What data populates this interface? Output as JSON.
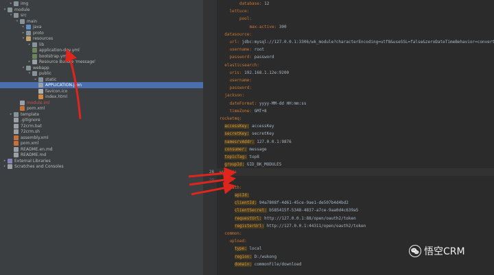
{
  "tree": {
    "rows": [
      {
        "label": "img",
        "indent": 1,
        "arrow": "▸",
        "icon": "folder",
        "icon_name": "folder-icon"
      },
      {
        "label": "module",
        "indent": 0,
        "arrow": "▾",
        "icon": "folder",
        "icon_name": "folder-icon"
      },
      {
        "label": "src",
        "indent": 1,
        "arrow": "▾",
        "icon": "folder",
        "icon_name": "folder-icon"
      },
      {
        "label": "main",
        "indent": 2,
        "arrow": "▾",
        "icon": "folder",
        "icon_name": "folder-icon"
      },
      {
        "label": "java",
        "indent": 3,
        "arrow": "▸",
        "icon": "folder-src",
        "icon_name": "source-folder-icon"
      },
      {
        "label": "proto",
        "indent": 3,
        "arrow": "▸",
        "icon": "folder",
        "icon_name": "folder-icon"
      },
      {
        "label": "resources",
        "indent": 3,
        "arrow": "▾",
        "icon": "folder-res",
        "icon_name": "resources-folder-icon"
      },
      {
        "label": "lib",
        "indent": 4,
        "arrow": "▸",
        "icon": "folder",
        "icon_name": "folder-icon"
      },
      {
        "label": "application-dev.yml",
        "indent": 4,
        "arrow": "",
        "icon": "file-yml",
        "icon_name": "yaml-file-icon"
      },
      {
        "label": "bootstrap.yml",
        "indent": 4,
        "arrow": "",
        "icon": "file-yml",
        "icon_name": "yaml-file-icon"
      },
      {
        "label": "Resource Bundle 'message'",
        "indent": 4,
        "arrow": "▸",
        "icon": "file-txt",
        "icon_name": "resource-bundle-icon"
      },
      {
        "label": "webapp",
        "indent": 3,
        "arrow": "▾",
        "icon": "folder",
        "icon_name": "folder-icon"
      },
      {
        "label": "public",
        "indent": 4,
        "arrow": "▾",
        "icon": "folder",
        "icon_name": "folder-icon"
      },
      {
        "label": "static",
        "indent": 5,
        "arrow": "▸",
        "icon": "folder",
        "icon_name": "folder-icon"
      },
      {
        "label": "APPLICATION.json",
        "indent": 5,
        "arrow": "",
        "icon": "file-txt",
        "icon_name": "json-file-icon",
        "selected": true
      },
      {
        "label": "favicon.ico",
        "indent": 5,
        "arrow": "",
        "icon": "file-ico",
        "icon_name": "image-file-icon"
      },
      {
        "label": "index.html",
        "indent": 5,
        "arrow": "",
        "icon": "file-html",
        "icon_name": "html-file-icon"
      },
      {
        "label": "module.iml",
        "indent": 2,
        "arrow": "",
        "icon": "file-txt",
        "icon_name": "module-file-icon",
        "style": "red-text"
      },
      {
        "label": "pom.xml",
        "indent": 2,
        "arrow": "",
        "icon": "file-xml",
        "icon_name": "xml-file-icon"
      },
      {
        "label": "template",
        "indent": 1,
        "arrow": "▸",
        "icon": "folder",
        "icon_name": "folder-icon"
      },
      {
        "label": ".gitignore",
        "indent": 1,
        "arrow": "",
        "icon": "file-txt",
        "icon_name": "text-file-icon"
      },
      {
        "label": "72crm.bat",
        "indent": 1,
        "arrow": "",
        "icon": "file-txt",
        "icon_name": "text-file-icon"
      },
      {
        "label": "72crm.sh",
        "indent": 1,
        "arrow": "",
        "icon": "file-txt",
        "icon_name": "text-file-icon"
      },
      {
        "label": "assembly.xml",
        "indent": 1,
        "arrow": "",
        "icon": "file-xml",
        "icon_name": "xml-file-icon"
      },
      {
        "label": "pom.xml",
        "indent": 1,
        "arrow": "",
        "icon": "file-xml",
        "icon_name": "xml-file-icon"
      },
      {
        "label": "README.en.md",
        "indent": 1,
        "arrow": "",
        "icon": "file-txt",
        "icon_name": "markdown-file-icon"
      },
      {
        "label": "README.md",
        "indent": 1,
        "arrow": "",
        "icon": "file-txt",
        "icon_name": "markdown-file-icon"
      },
      {
        "label": "External Libraries",
        "indent": 0,
        "arrow": "▸",
        "icon": "lib",
        "icon_name": "library-icon"
      },
      {
        "label": "Scratches and Consoles",
        "indent": 0,
        "arrow": "▸",
        "icon": "file-txt",
        "icon_name": "scratches-icon"
      }
    ]
  },
  "editor": {
    "lines": [
      {
        "indent": 4,
        "key": "database:",
        "value": " 12"
      },
      {
        "indent": 2,
        "key": "lettuce:",
        "value": ""
      },
      {
        "indent": 4,
        "key": "pool:",
        "value": ""
      },
      {
        "indent": 6,
        "key": "max-active:",
        "value": " 300"
      },
      {
        "indent": 1,
        "key": "datasource:",
        "value": ""
      },
      {
        "indent": 2,
        "key": "url:",
        "value": " jdbc:mysql://127.0.0.1:3306/wk_module?characterEncoding=utf8&useSSL=false&zeroDateTimeBehavior=convert"
      },
      {
        "indent": 2,
        "key": "username:",
        "value": " root"
      },
      {
        "indent": 2,
        "key": "password:",
        "value": " password"
      },
      {
        "indent": 1,
        "key": "elasticsearch:",
        "value": ""
      },
      {
        "indent": 2,
        "key": "uris:",
        "value": " 192.168.1.12e:9200"
      },
      {
        "indent": 2,
        "key": "username:",
        "value": ""
      },
      {
        "indent": 2,
        "key": "password:",
        "value": ""
      },
      {
        "indent": 1,
        "key": "jackson:",
        "value": ""
      },
      {
        "indent": 2,
        "key": "dateFormat:",
        "value": " yyyy-MM-dd HH:mm:ss"
      },
      {
        "indent": 2,
        "key": "timeZone:",
        "value": " GMT+8"
      },
      {
        "indent": 0,
        "key": "rocketmq:",
        "value": ""
      },
      {
        "indent": 1,
        "key": "accessKey:",
        "value": " accessKey",
        "hl": true
      },
      {
        "indent": 1,
        "key": "secretKey:",
        "value": " secretKey",
        "hl": true
      },
      {
        "indent": 1,
        "key": "namesrvAddr:",
        "value": " 127.0.0.1:9876",
        "hl": true
      },
      {
        "indent": 1,
        "key": "consumer:",
        "value": " message",
        "hl": true
      },
      {
        "indent": 1,
        "key": "topicTag:",
        "value": " top8",
        "hl": true
      },
      {
        "indent": 1,
        "key": "groupId:",
        "value": " GID_BK_MODULES",
        "hl": true
      },
      {
        "indent": 0,
        "key": "wukong:",
        "value": "",
        "current": true
      },
      {
        "indent": 1,
        "key": "ias:",
        "value": ""
      },
      {
        "indent": 2,
        "key": "oath:",
        "value": ""
      },
      {
        "indent": 3,
        "key": "apiId:",
        "value": "",
        "hl": true
      },
      {
        "indent": 3,
        "key": "clientId:",
        "value": " 94a7808f-4d61-45ce-9ae1-de507b4d4bd2",
        "hl": true
      },
      {
        "indent": 3,
        "key": "clientSecret:",
        "value": " b585415f-5348-4837-a7ce-9aa0d4c639a5",
        "hl": true
      },
      {
        "indent": 3,
        "key": "requestUrl:",
        "value": " http://127.0.0.1:88/open/oauth2/token",
        "hl": true
      },
      {
        "indent": 3,
        "key": "registerUrl:",
        "value": " http://127.0.0.1:44311/open/oauth2/token",
        "hl": true
      },
      {
        "indent": 1,
        "key": "common:",
        "value": ""
      },
      {
        "indent": 2,
        "key": "upload:",
        "value": ""
      },
      {
        "indent": 3,
        "key": "type:",
        "value": " local",
        "hl": true
      },
      {
        "indent": 3,
        "key": "region:",
        "value": " D:/wukong",
        "hl": true
      },
      {
        "indent": 3,
        "key": "domain:",
        "value": " commonFile/download",
        "hl": true
      }
    ],
    "gutter_numbers": [
      {
        "n": "28",
        "line": 22,
        "current": true
      },
      {
        "n": "29",
        "line": 23
      }
    ]
  },
  "watermark": {
    "text": "悟空CRM"
  },
  "colors": {
    "arrow": "#e0261c",
    "tree_bg": "#3c3f41",
    "editor_bg": "#2b2b2b",
    "selection": "#4b6eaf",
    "yaml_key": "#cc7832"
  }
}
